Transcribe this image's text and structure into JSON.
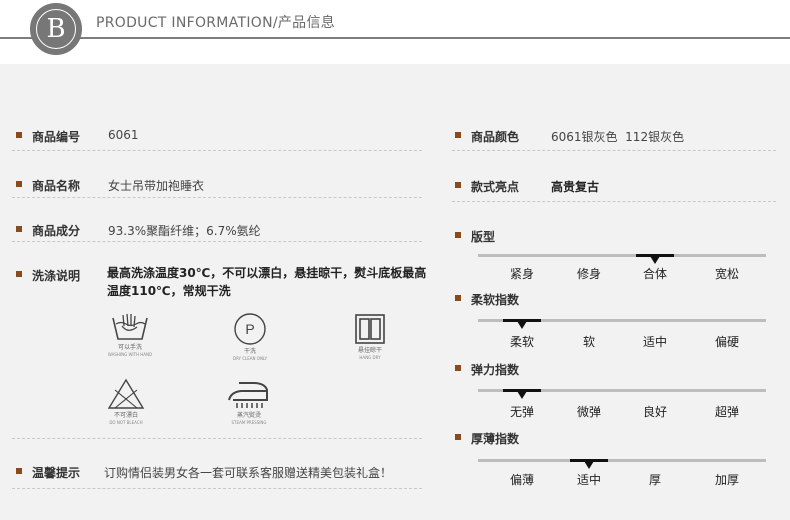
{
  "header": {
    "logo_letter": "B",
    "title": "PRODUCT INFORMATION/产品信息"
  },
  "left": {
    "item_no": {
      "label": "商品编号",
      "value": "6061"
    },
    "name": {
      "label": "商品名称",
      "value": "女士吊带加袍睡衣"
    },
    "composition": {
      "label": "商品成分",
      "value": "93.3%聚酯纤维；6.7%氨纶"
    },
    "wash": {
      "label": "洗涤说明",
      "text": "最高洗涤温度30℃，不可以漂白，悬挂晾干，熨斗底板最高温度110℃，常规干洗"
    },
    "care_icons": [
      {
        "icon": "hand-wash-icon",
        "cn": "可以手洗",
        "en": "WASHING WITH HAND"
      },
      {
        "icon": "dry-clean-icon",
        "cn": "干洗",
        "en": "DRY CLEAN ONLY"
      },
      {
        "icon": "hang-dry-icon",
        "cn": "悬挂晾干",
        "en": "HANG DRY"
      },
      {
        "icon": "no-bleach-icon",
        "cn": "不可漂白",
        "en": "DO NOT BLEACH"
      },
      {
        "icon": "steam-iron-icon",
        "cn": "蒸汽熨烫",
        "en": "STEAM PRESSING"
      }
    ],
    "tips": {
      "label": "温馨提示",
      "value": "订购情侣装男女各一套可联系客服赠送精美包装礼盒！"
    }
  },
  "right": {
    "color": {
      "label": "商品颜色",
      "value": "6061银灰色  112银灰色"
    },
    "style": {
      "label": "款式亮点",
      "value": "高贵复古"
    },
    "scales": [
      {
        "label": "版型",
        "options": [
          "紧身",
          "修身",
          "合体",
          "宽松"
        ],
        "selected_index": 2
      },
      {
        "label": "柔软指数",
        "options": [
          "柔软",
          "软",
          "适中",
          "偏硬"
        ],
        "selected_index": 0
      },
      {
        "label": "弹力指数",
        "options": [
          "无弹",
          "微弹",
          "良好",
          "超弹"
        ],
        "selected_index": 0
      },
      {
        "label": "厚薄指数",
        "options": [
          "偏薄",
          "适中",
          "厚",
          "加厚"
        ],
        "selected_index": 1
      }
    ]
  },
  "colors": {
    "bullet": "#8b4a1c",
    "panel_bg": "#f2f2f2",
    "header_line": "#7d7d7d",
    "logo_bg": "#777777"
  }
}
